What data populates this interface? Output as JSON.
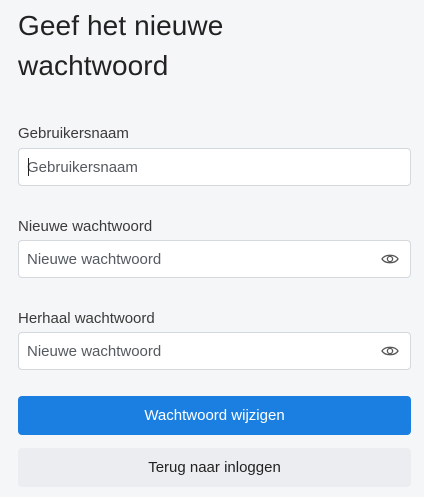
{
  "page": {
    "title": "Geef het nieuwe wachtwoord"
  },
  "form": {
    "username": {
      "label": "Gebruikersnaam",
      "placeholder": "Gebruikersnaam",
      "value": ""
    },
    "new_password": {
      "label": "Nieuwe wachtwoord",
      "placeholder": "Nieuwe wachtwoord",
      "value": "",
      "toggle_icon": "eye-icon"
    },
    "repeat_password": {
      "label": "Herhaal wachtwoord",
      "placeholder": "Nieuwe wachtwoord",
      "value": "",
      "toggle_icon": "eye-icon"
    }
  },
  "actions": {
    "submit_label": "Wachtwoord wijzigen",
    "back_label": "Terug naar inloggen"
  },
  "colors": {
    "background": "#f5f6f7",
    "primary": "#1a7fe0",
    "secondary": "#ebedf0",
    "input_border": "#d5d8dc"
  }
}
